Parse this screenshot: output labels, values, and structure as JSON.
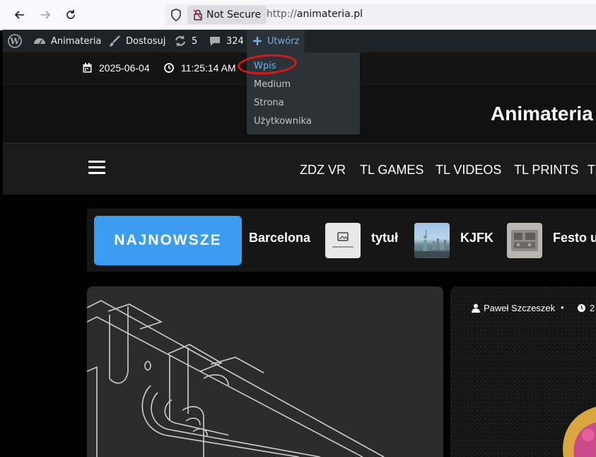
{
  "browser": {
    "security_label": "Not Secure",
    "url_scheme": "http://",
    "url_host": "animateria.pl"
  },
  "adminbar": {
    "site_name": "Animateria",
    "customize": "Dostosuj",
    "updates_count": "5",
    "comments_count": "324",
    "create_label": "Utwórz",
    "create_menu": [
      "Wpis",
      "Medium",
      "Strona",
      "Użytkownika"
    ]
  },
  "topbar": {
    "date": "2025-06-04",
    "time": "11:25:14 AM"
  },
  "site": {
    "title": "Animateria"
  },
  "nav": {
    "items": [
      "ZDZ VR",
      "TL GAMES",
      "TL VIDEOS",
      "TL PRINTS",
      "T"
    ]
  },
  "ticker": {
    "label": "NAJNOWSZE",
    "items": [
      "Barcelona",
      "tytuł",
      "KJFK",
      "Festo u"
    ]
  },
  "featured": {
    "author": "Paweł Szczeszek",
    "date_partial": "2"
  },
  "colors": {
    "accent": "#3c9df0",
    "admin_bg": "#1d2327",
    "admin_link": "#72aee6",
    "annotation": "#e0151a"
  }
}
